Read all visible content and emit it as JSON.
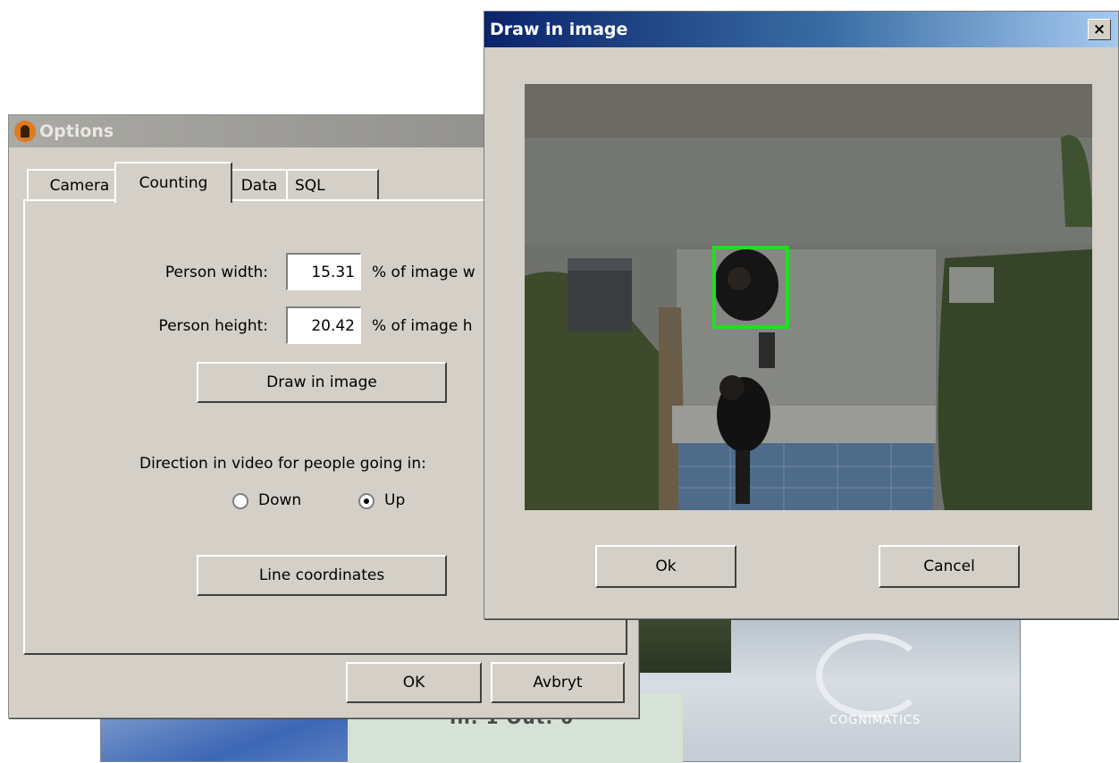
{
  "options_dialog": {
    "title": "Options",
    "tabs": [
      {
        "label": "Camera"
      },
      {
        "label": "Counting"
      },
      {
        "label": "Data"
      },
      {
        "label": "SQL"
      }
    ],
    "person_width": {
      "label": "Person width:",
      "value": "15.31",
      "unit": "% of image w"
    },
    "person_height": {
      "label": "Person height:",
      "value": "20.42",
      "unit": "% of image h"
    },
    "draw_button": "Draw in image",
    "direction_label": "Direction in video for people going in:",
    "direction_options": [
      {
        "label": "Down",
        "selected": false
      },
      {
        "label": "Up",
        "selected": true
      }
    ],
    "line_coords_button": "Line coordinates",
    "ok_button": "OK",
    "cancel_button": "Avbryt"
  },
  "draw_dialog": {
    "title": "Draw in image",
    "close_glyph": "×",
    "ok_button": "Ok",
    "cancel_button": "Cancel",
    "selection_color": "#1ee01e"
  },
  "background_app": {
    "counter_text": "In: 1   Out: 0",
    "logo_text": "COGNIMATICS"
  }
}
